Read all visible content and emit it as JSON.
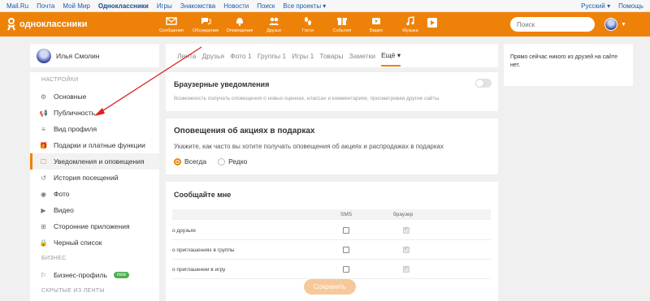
{
  "topbar": {
    "links": [
      "Mail.Ru",
      "Почта",
      "Мой Мир",
      "Одноклассники",
      "Игры",
      "Знакомства",
      "Новости",
      "Поиск",
      "Все проекты ▾"
    ],
    "active_index": 3,
    "lang": "Русский ▾",
    "help": "Помощь"
  },
  "header": {
    "logo_text": "одноклассники",
    "nav": [
      {
        "icon": "mail-icon",
        "label": "Сообщения"
      },
      {
        "icon": "discussions-icon",
        "label": "Обсуждения"
      },
      {
        "icon": "bell-icon",
        "label": "Оповещения"
      },
      {
        "icon": "friends-icon",
        "label": "Друзья"
      },
      {
        "icon": "footprints-icon",
        "label": "Гости"
      },
      {
        "icon": "events-icon",
        "label": "События"
      },
      {
        "icon": "video-icon",
        "label": "Видео"
      },
      {
        "icon": "music-icon",
        "label": "Музыка"
      }
    ],
    "search_placeholder": "Поиск"
  },
  "profile": {
    "name": "Илья Смолин"
  },
  "tabs": [
    "Лента",
    "Друзья",
    "Фото 1",
    "Группы 1",
    "Игры 1",
    "Товары",
    "Заметки",
    "Ещё ▾"
  ],
  "menu": {
    "settings_title": "НАСТРОЙКИ",
    "items": [
      {
        "icon": "gear-icon",
        "label": "Основные"
      },
      {
        "icon": "megaphone-icon",
        "label": "Публичность"
      },
      {
        "icon": "profile-view-icon",
        "label": "Вид профиля"
      },
      {
        "icon": "gift-icon",
        "label": "Подарки и платные функции"
      },
      {
        "icon": "notifications-icon",
        "label": "Уведомления и оповещения"
      },
      {
        "icon": "history-icon",
        "label": "История посещений"
      },
      {
        "icon": "camera-icon",
        "label": "Фото"
      },
      {
        "icon": "video-camera-icon",
        "label": "Видео"
      },
      {
        "icon": "apps-icon",
        "label": "Сторонние приложения"
      },
      {
        "icon": "lock-icon",
        "label": "Черный список"
      }
    ],
    "active_index": 4,
    "business_title": "БИЗНЕС",
    "business_item": {
      "icon": "business-icon",
      "label": "Бизнес-профиль",
      "badge": "new"
    },
    "hidden_title": "СКРЫТЫЕ ИЗ ЛЕНТЫ"
  },
  "browser_notifications": {
    "title": "Браузерные уведомления",
    "desc": "Возможность получать оповещения о новых оценках, классах и комментариях, просматривая другие сайты.",
    "enabled": false
  },
  "gift_notifications": {
    "title": "Оповещения об акциях в подарках",
    "desc": "Укажите, как часто вы хотите получать оповещения об акциях и распродажах в подарках",
    "options": [
      "Всегда",
      "Редко"
    ],
    "selected": "Всегда"
  },
  "report": {
    "title": "Сообщайте мне",
    "col_sms": "SMS",
    "col_browser": "браузер",
    "rows": [
      {
        "label": "о друзьях",
        "sms": false,
        "browser": true
      },
      {
        "label": "о приглашениях в группы",
        "sms": false,
        "browser": true
      },
      {
        "label": "о приглашении в игру",
        "sms": false,
        "browser": true
      }
    ],
    "save_label": "Сохранить"
  },
  "right_panel": {
    "text": "Прямо сейчас никого из друзей на сайте нет."
  },
  "colors": {
    "accent": "#ee8208",
    "link": "#1a5aa8",
    "annotation_arrow": "#e02020"
  }
}
